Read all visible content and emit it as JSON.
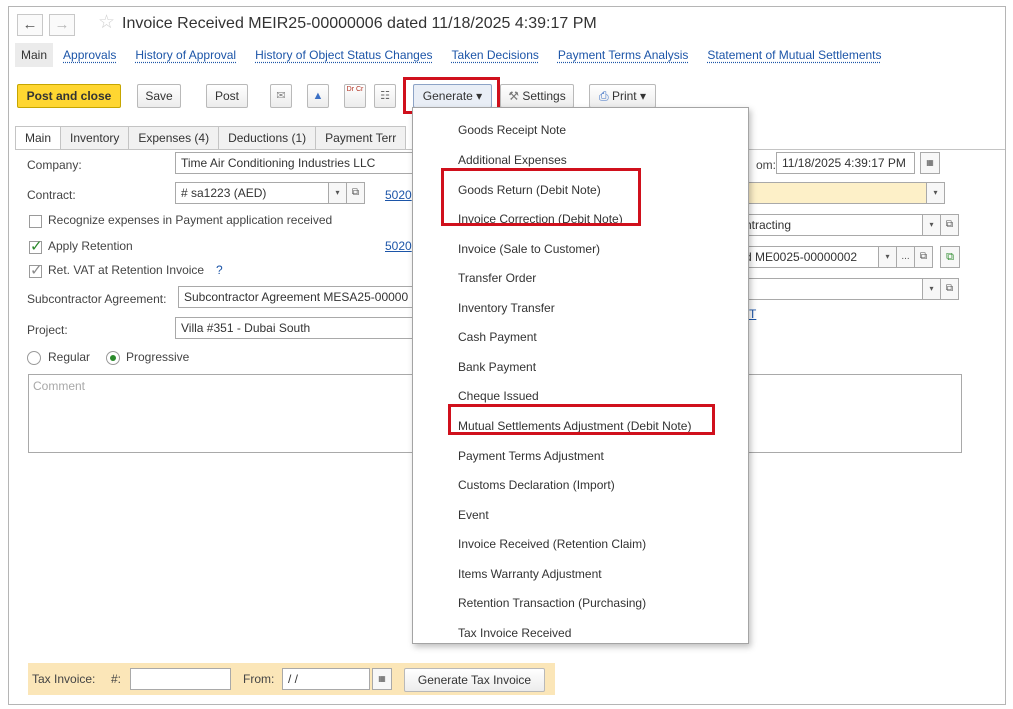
{
  "window": {
    "back_glyph": "←",
    "forward_glyph": "→",
    "star_glyph": "☆",
    "title": "Invoice Received MEIR25-00000006 dated 11/18/2025 4:39:17 PM"
  },
  "section_links": [
    "Main",
    "Approvals",
    "History of Approval",
    "History of Object Status Changes",
    "Taken Decisions",
    "Payment Terms Analysis",
    "Statement of Mutual Settlements"
  ],
  "toolbar": {
    "post_close": "Post and close",
    "save": "Save",
    "post": "Post",
    "attach_glyph": "✉",
    "bell_glyph": "▲",
    "drcr_glyph": "Dr Cr",
    "structure_glyph": "☷",
    "generate": "Generate ▾",
    "settings": "Settings",
    "settings_glyph": "⚒",
    "print": "Print ▾",
    "print_glyph": "⎙"
  },
  "tabs": [
    "Main",
    "Inventory",
    "Expenses (4)",
    "Deductions (1)",
    "Payment Terr"
  ],
  "form": {
    "company_label": "Company:",
    "company_value": "Time Air Conditioning Industries LLC",
    "contract_label": "Contract:",
    "contract_value": "# sa1223 (AED)",
    "contract_link": "5020",
    "recognize_label": "Recognize expenses in Payment application received",
    "apply_retention_label": "Apply Retention",
    "retention_link": "5020",
    "ret_vat_label": "Ret. VAT at Retention Invoice",
    "ret_vat_help": "?",
    "subcontractor_label": "Subcontractor Agreement:",
    "subcontractor_value": "Subcontractor Agreement MESA25-00000",
    "project_label": "Project:",
    "project_value": "Villa #351 - Dubai South",
    "regular_label": "Regular",
    "progressive_label": "Progressive",
    "comment_placeholder": "Comment",
    "from_label": "om:",
    "from_value": "11/18/2025  4:39:17 PM",
    "calendar_glyph": "▦",
    "dropdown_glyph": "▾",
    "open_glyph": "⧉",
    "yellow_field_value": "",
    "contracting_value": "ntracting",
    "me_value": "d ME0025-00000002",
    "ellipsis": "...",
    "t_link": "T"
  },
  "tax_invoice": {
    "label": "Tax Invoice:",
    "number_label": "#:",
    "number_value": "",
    "from_label": "From:",
    "from_value": " / /",
    "generate_button": "Generate Tax Invoice"
  },
  "generate_menu": [
    "Goods Receipt Note",
    "Additional Expenses",
    "Goods Return (Debit Note)",
    "Invoice Correction (Debit Note)",
    "Invoice (Sale to Customer)",
    "Transfer Order",
    "Inventory Transfer",
    "Cash Payment",
    "Bank Payment",
    "Cheque Issued",
    "Mutual Settlements Adjustment (Debit Note)",
    "Payment Terms Adjustment",
    "Customs Declaration (Import)",
    "Event",
    "Invoice Received (Retention Claim)",
    "Items Warranty Adjustment",
    "Retention Transaction (Purchasing)",
    "Tax Invoice Received"
  ],
  "colors": {
    "highlight": "#d0101c",
    "primary_button": "#ffd631",
    "link": "#1c55a8",
    "tax_strip": "#fbe6b8"
  }
}
